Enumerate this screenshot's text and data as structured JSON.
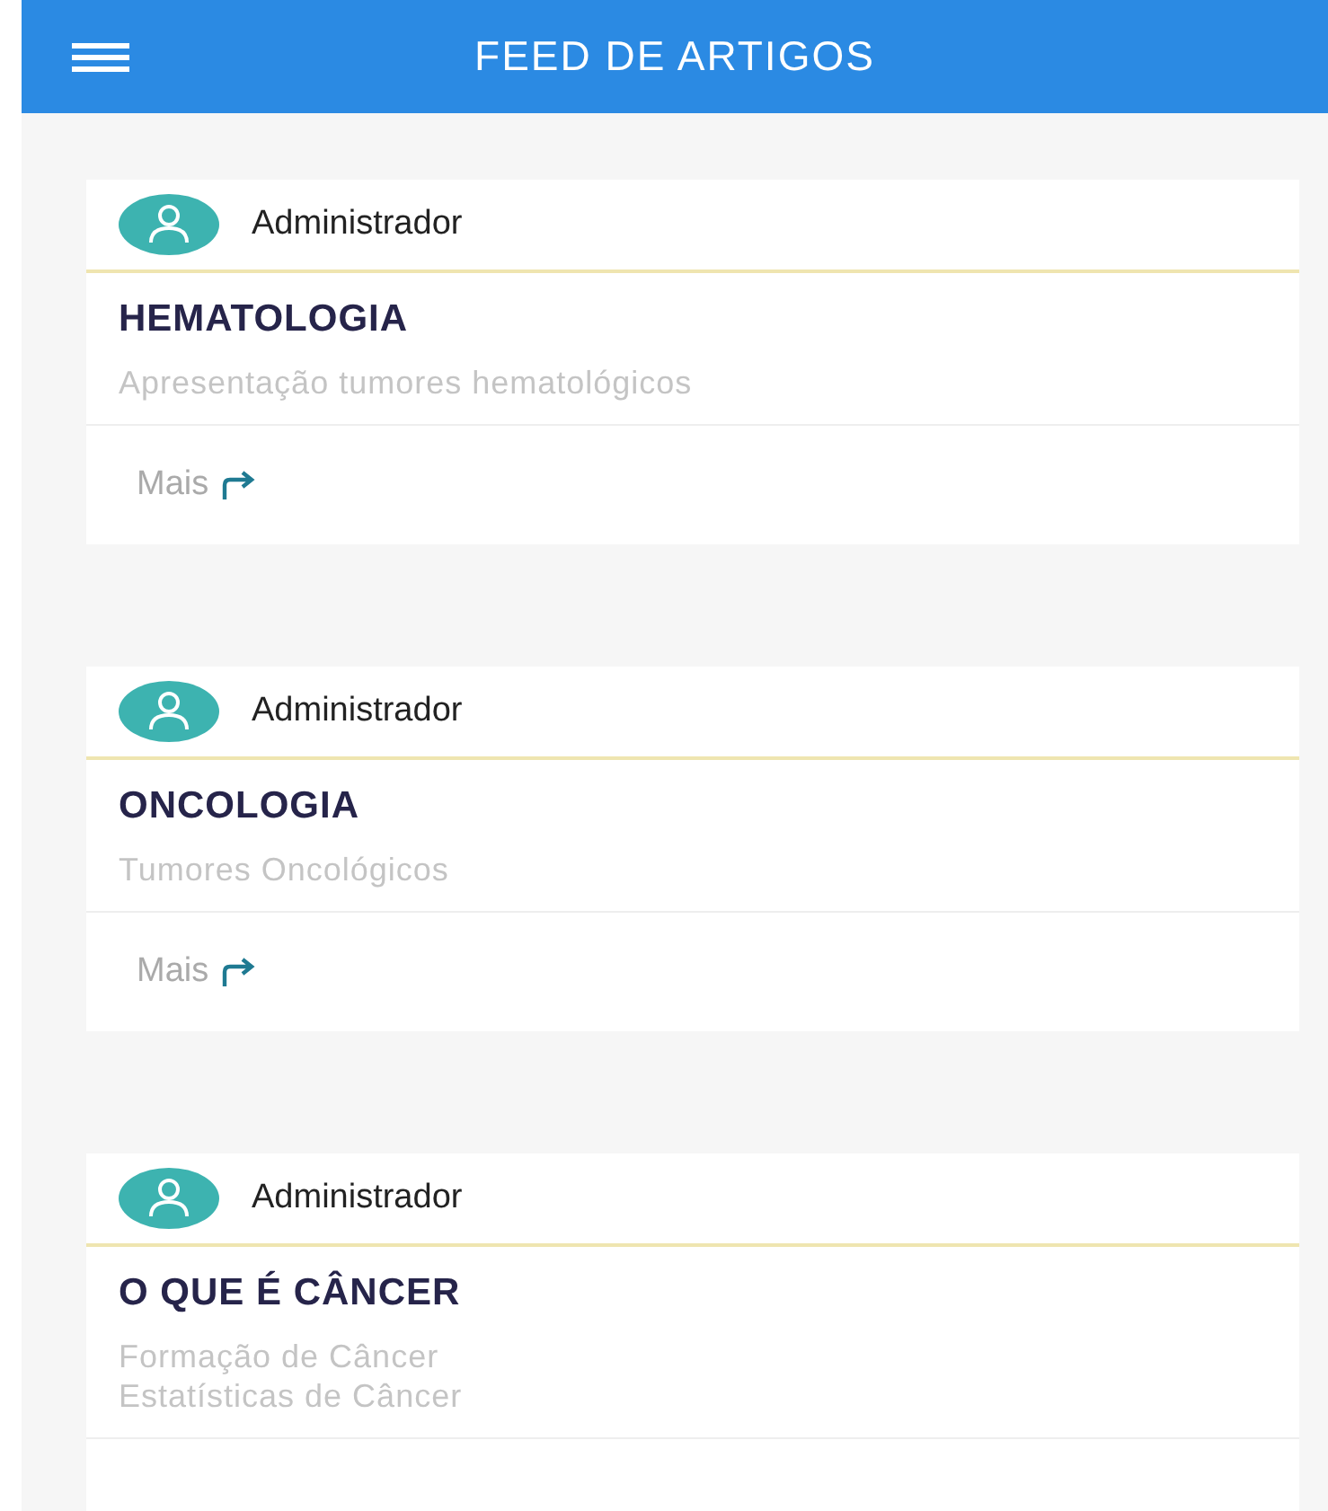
{
  "app_bar": {
    "title": "FEED DE ARTIGOS"
  },
  "articles": [
    {
      "author": "Administrador",
      "title": "HEMATOLOGIA",
      "description": [
        "Apresentação tumores hematológicos"
      ],
      "more": "Mais"
    },
    {
      "author": "Administrador",
      "title": "ONCOLOGIA",
      "description": [
        "Tumores Oncológicos"
      ],
      "more": "Mais"
    },
    {
      "author": "Administrador",
      "title": "O QUE É CÂNCER",
      "description": [
        "Formação de Câncer",
        "Estatísticas de Câncer"
      ]
    }
  ]
}
